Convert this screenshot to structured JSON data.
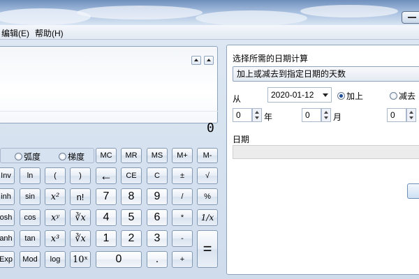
{
  "menu": {
    "edit": "编辑(E)",
    "help": "帮助(H)"
  },
  "display": {
    "value": "0"
  },
  "angle_units": {
    "gradians": "弧度",
    "radians": "梯度"
  },
  "memory": [
    "MC",
    "MR",
    "MS",
    "M+",
    "M-"
  ],
  "keys": {
    "inv": "Inv",
    "ln": "ln",
    "lparen": "(",
    "rparen": ")",
    "backspace": "←",
    "ce": "CE",
    "c": "C",
    "plusminus": "±",
    "sqrt": "√",
    "sinh": "inh",
    "sin": "sin",
    "x2": "x²",
    "nfact": "n!",
    "d7": "7",
    "d8": "8",
    "d9": "9",
    "div": "/",
    "percent": "%",
    "cosh": "osh",
    "cos": "cos",
    "xy": "xʸ",
    "yroot": "∛x",
    "d4": "4",
    "d5": "5",
    "d6": "6",
    "mul": "*",
    "recip": "1/x",
    "tanh": "anh",
    "tan": "tan",
    "x3": "x³",
    "cbrt": "∛x",
    "d1": "1",
    "d2": "2",
    "d3": "3",
    "sub": "-",
    "equals": "=",
    "exp": "Exp",
    "mod": "Mod",
    "log": "log",
    "tenx": "10ˣ",
    "d0": "0",
    "dot": ".",
    "add": "+"
  },
  "date_panel": {
    "heading": "选择所需的日期计算",
    "mode": "加上或减去到指定日期的天数",
    "from_label": "从",
    "date": "2020-01-12",
    "add_label": "加上",
    "subtract_label": "减去",
    "years_value": "0",
    "years_label": "年",
    "months_value": "0",
    "months_label": "月",
    "days_value": "0",
    "date_label": "日期"
  }
}
